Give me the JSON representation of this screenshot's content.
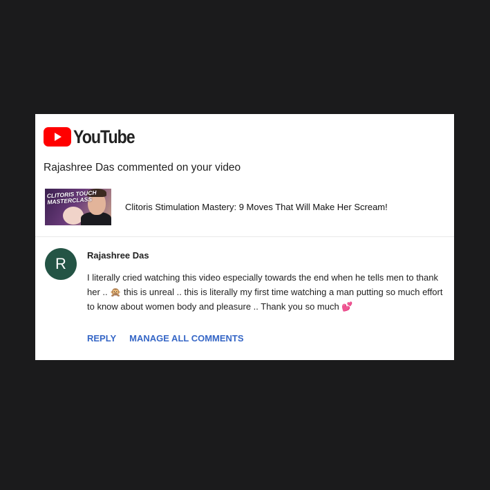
{
  "brand": {
    "name": "YouTube",
    "accent_color": "#ff0000",
    "logo_icon": "youtube-play-icon"
  },
  "notification": {
    "headline": "Rajashree Das commented on your video"
  },
  "video": {
    "thumbnail_text": "CLITORIS TOUCH\nMASTERCLASS",
    "title": "Clitoris Stimulation Mastery: 9 Moves That Will Make Her Scream!"
  },
  "comment": {
    "avatar_letter": "R",
    "avatar_color": "#245445",
    "author": "Rajashree Das",
    "body": "I literally cried watching this video especially towards the end when he tells men to thank her .. 🙊 this is unreal .. this is literally my first time watching a man putting so much effort to know about women body and pleasure .. Thank you so much 💕"
  },
  "actions": {
    "reply_label": "REPLY",
    "manage_label": "MANAGE ALL COMMENTS",
    "link_color": "#3566c6"
  }
}
